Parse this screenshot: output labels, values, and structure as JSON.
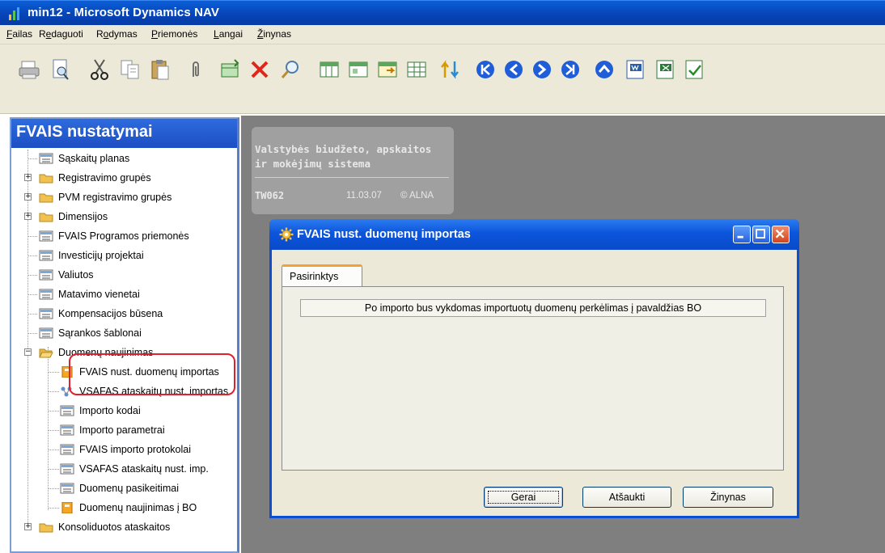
{
  "window": {
    "title": "min12 - Microsoft Dynamics NAV"
  },
  "menu": [
    {
      "label": "Failas",
      "mnemonic": "F"
    },
    {
      "label": "Redaguoti",
      "mnemonic": "e"
    },
    {
      "label": "Rodymas",
      "mnemonic": "o"
    },
    {
      "label": "Priemonės",
      "mnemonic": "P"
    },
    {
      "label": "Langai",
      "mnemonic": "L"
    },
    {
      "label": "Žinynas",
      "mnemonic": "Ž"
    }
  ],
  "toolbar": {
    "icons": [
      "print-icon",
      "print-preview-icon",
      "cut-icon",
      "copy-icon",
      "paste-icon",
      "attach-icon",
      "new-record-icon",
      "delete-icon",
      "find-icon",
      "table-icon",
      "card-icon",
      "list-icon",
      "grid-icon",
      "sort-icon",
      "first-record-icon",
      "previous-record-icon",
      "next-record-icon",
      "last-record-icon",
      "up-icon",
      "export-word-icon",
      "export-excel-icon",
      "send-icon"
    ]
  },
  "nav": {
    "title": "FVAIS nustatymai",
    "items": [
      {
        "label": "Sąskaitų planas",
        "icon": "list-icon",
        "expander": ""
      },
      {
        "label": "Registravimo grupės",
        "icon": "folder-icon",
        "expander": "+"
      },
      {
        "label": "PVM registravimo grupės",
        "icon": "folder-icon",
        "expander": "+"
      },
      {
        "label": "Dimensijos",
        "icon": "folder-icon",
        "expander": "+"
      },
      {
        "label": "FVAIS Programos priemonės",
        "icon": "list-icon",
        "expander": ""
      },
      {
        "label": "Investicijų projektai",
        "icon": "list-icon",
        "expander": ""
      },
      {
        "label": "Valiutos",
        "icon": "list-icon",
        "expander": ""
      },
      {
        "label": "Matavimo vienetai",
        "icon": "list-icon",
        "expander": ""
      },
      {
        "label": "Kompensacijos būsena",
        "icon": "list-icon",
        "expander": ""
      },
      {
        "label": "Sąrankos šablonai",
        "icon": "list-icon",
        "expander": ""
      },
      {
        "label": "Duomenų naujinimas",
        "icon": "folder-open-icon",
        "expander": "−"
      },
      {
        "label": "FVAIS nust. duomenų importas",
        "icon": "report-icon",
        "expander": ""
      },
      {
        "label": "VSAFAS ataskaitų nust. importas",
        "icon": "dataport-icon",
        "expander": ""
      },
      {
        "label": "Importo kodai",
        "icon": "list-icon",
        "expander": ""
      },
      {
        "label": "Importo parametrai",
        "icon": "list-icon",
        "expander": ""
      },
      {
        "label": "FVAIS importo protokolai",
        "icon": "list-icon",
        "expander": ""
      },
      {
        "label": "VSAFAS ataskaitų nust. imp.",
        "icon": "list-icon",
        "expander": ""
      },
      {
        "label": "Duomenų pasikeitimai",
        "icon": "list-icon",
        "expander": ""
      },
      {
        "label": "Duomenų naujinimas į BO",
        "icon": "report-icon",
        "expander": ""
      },
      {
        "label": "Konsoliduotos ataskaitos",
        "icon": "folder-icon",
        "expander": "+"
      }
    ]
  },
  "infobox": {
    "line1": "Valstybės biudžeto, apskaitos",
    "line2": "ir mokėjimų sistema",
    "code": "TW062",
    "date": "11.03.07",
    "copyright": "© ALNA"
  },
  "dialog": {
    "title": "FVAIS nust. duomenų importas",
    "tab": "Pasirinktys",
    "info": "Po importo bus vykdomas importuotų duomenų perkėlimas į pavaldžias BO",
    "buttons": {
      "ok": "Gerai",
      "cancel": "Atšaukti",
      "help": "Žinynas"
    }
  },
  "colors": {
    "titlebar": "#0745b8",
    "chrome": "#ece9d8",
    "workspace": "#7f7f7f",
    "highlight": "#e0202a"
  }
}
